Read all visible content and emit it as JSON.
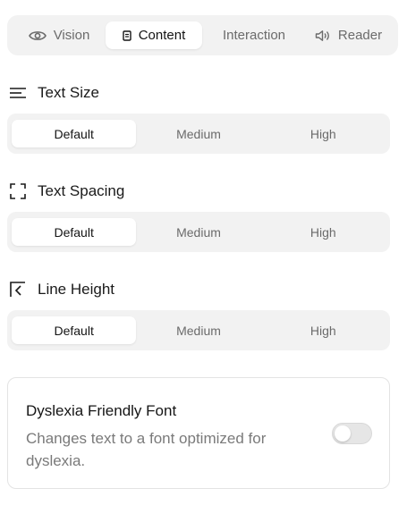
{
  "tabs": [
    {
      "label": "Vision",
      "icon": "eye-icon"
    },
    {
      "label": "Content",
      "icon": "document-icon",
      "active": true
    },
    {
      "label": "Interaction",
      "icon": ""
    },
    {
      "label": "Reader",
      "icon": "speaker-icon"
    }
  ],
  "sections": [
    {
      "title": "Text Size",
      "icon": "text-lines-icon",
      "options": [
        "Default",
        "Medium",
        "High"
      ],
      "selected": "Default"
    },
    {
      "title": "Text Spacing",
      "icon": "expand-corners-icon",
      "options": [
        "Default",
        "Medium",
        "High"
      ],
      "selected": "Default"
    },
    {
      "title": "Line Height",
      "icon": "line-height-icon",
      "options": [
        "Default",
        "Medium",
        "High"
      ],
      "selected": "Default"
    }
  ],
  "dyslexia": {
    "title": "Dyslexia Friendly Font",
    "description": "Changes text to a font optimized for dyslexia.",
    "enabled": false
  },
  "colors": {
    "panel_bg": "#f2f2f2",
    "active_bg": "#ffffff",
    "text_primary": "#141414",
    "text_muted": "#6b6b6b"
  }
}
